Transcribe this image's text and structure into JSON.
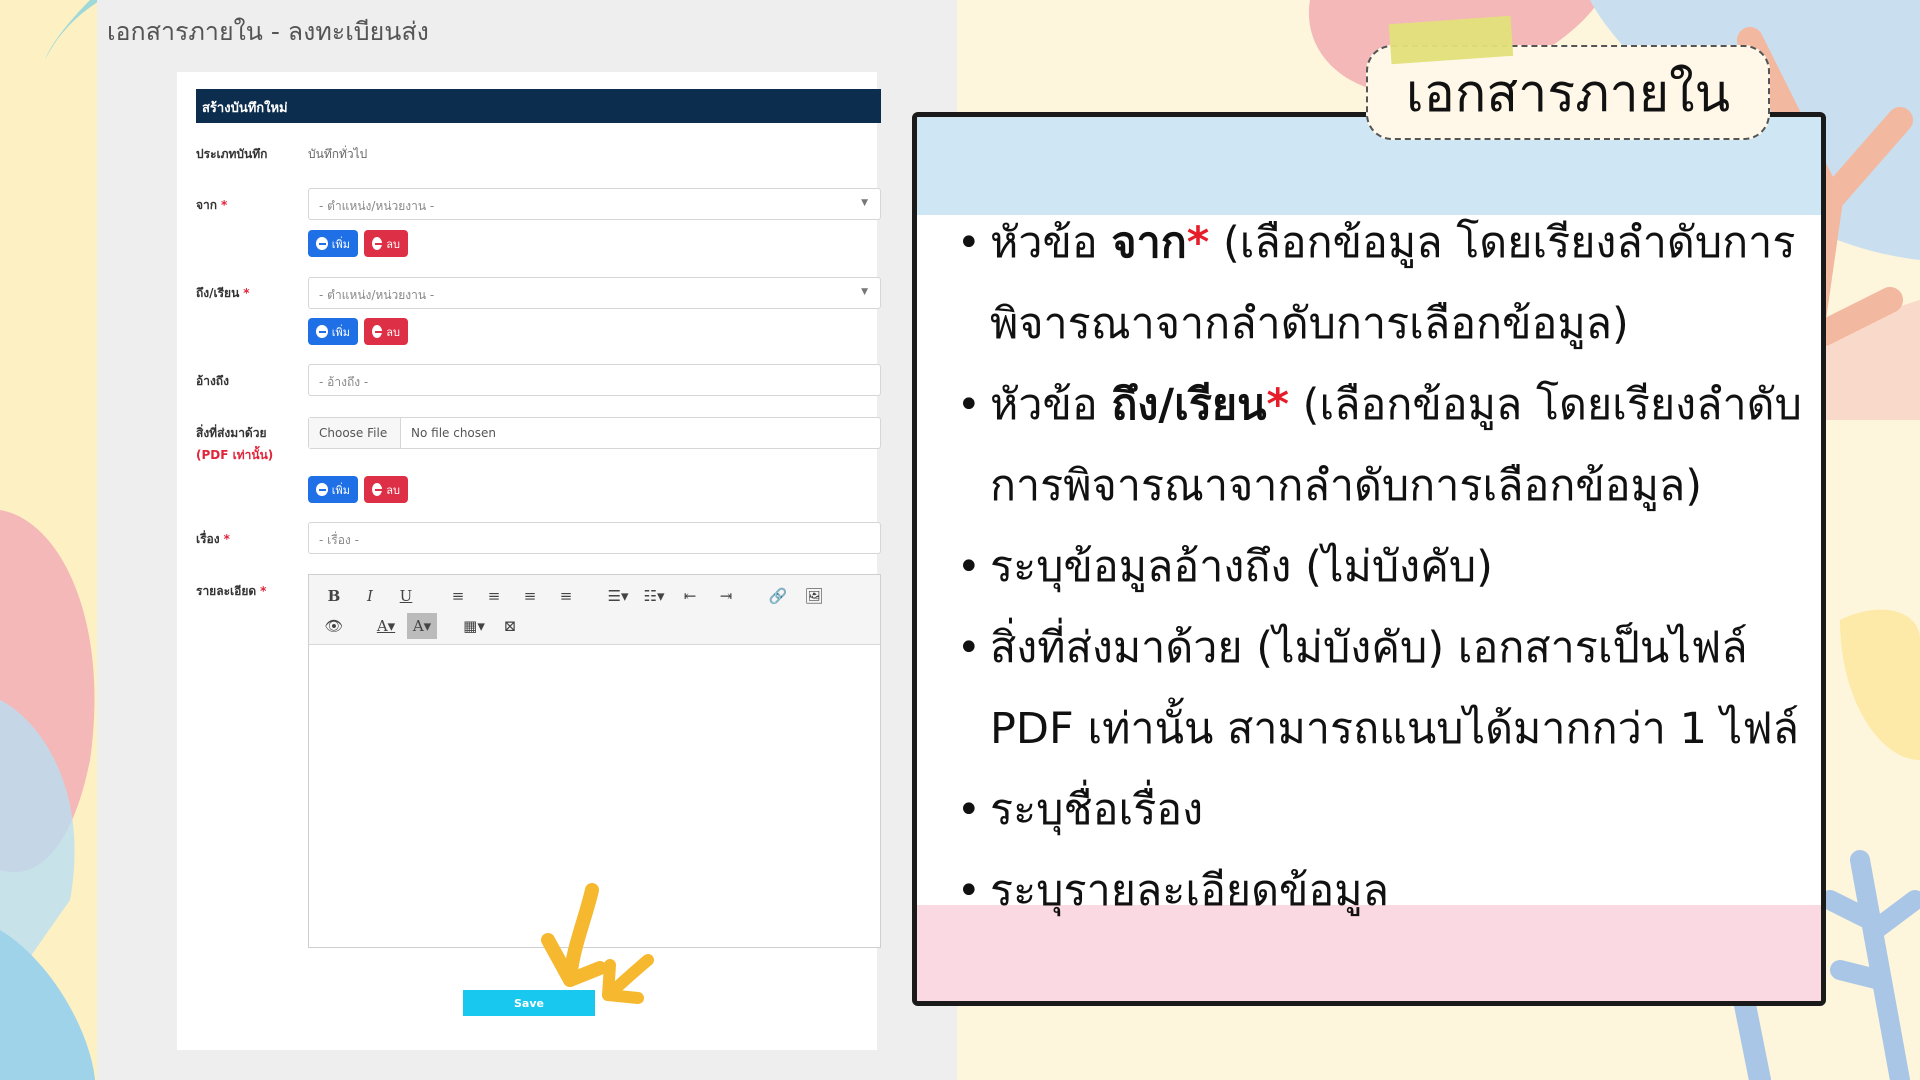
{
  "page_heading": "เอกสารภายใน - ลงทะเบียนส่ง",
  "form": {
    "header": "สร้างบันทึกใหม่",
    "record_type_label": "ประเภทบันทึก",
    "record_type_value": "บันทึกทั่วไป",
    "from_label": "จาก",
    "from_placeholder": "- ตำแหน่ง/หน่วยงาน -",
    "to_label": "ถึง/เรียน",
    "to_placeholder": "- ตำแหน่ง/หน่วยงาน -",
    "ref_label": "อ้างถึง",
    "ref_placeholder": "- อ้างถึง -",
    "attach_label": "สิ่งที่ส่งมาด้วย",
    "attach_note": "(PDF เท่านั้น)",
    "choose_file": "Choose File",
    "no_file": "No file chosen",
    "subject_label": "เรื่อง",
    "subject_placeholder": "- เรื่อง -",
    "detail_label": "รายละเอียด",
    "required_mark": "*",
    "add_label": "เพิ่ม",
    "delete_label": "ลบ",
    "save_label": "Save",
    "toolbar_row1": [
      "B",
      "I",
      "U",
      "≡",
      "≡",
      "≡",
      "≡",
      "☰▾",
      "☷▾",
      "⇤",
      "⇥",
      "🔗",
      "🖼"
    ],
    "toolbar_row2": [
      "👁",
      "A▾",
      "A▾",
      "▦▾",
      "⊠"
    ]
  },
  "note": {
    "title": "เอกสารภายใน",
    "items": [
      {
        "pre": "หัวข้อ ",
        "kw": "จาก",
        "star": "*",
        "post": " (เลือกข้อมูล โดยเรียงลำดับการพิจารณาจากลำดับการเลือกข้อมูล)"
      },
      {
        "pre": "หัวข้อ ",
        "kw": "ถึง/เรียน",
        "star": "*",
        "post": " (เลือกข้อมูล โดยเรียงลำดับการพิจารณาจากลำดับการเลือกข้อมูล)"
      },
      {
        "pre": "ระบุข้อมูลอ้างถึง (ไม่บังคับ)",
        "kw": "",
        "star": "",
        "post": ""
      },
      {
        "pre": "สิ่งที่ส่งมาด้วย (ไม่บังคับ) เอกสารเป็นไฟล์ PDF เท่านั้น สามารถแนบได้มากกว่า 1 ไฟล์",
        "kw": "",
        "star": "",
        "post": ""
      },
      {
        "pre": "ระบุชื่อเรื่อง",
        "kw": "",
        "star": "",
        "post": ""
      },
      {
        "pre": "ระบุรายละเอียดข้อมูล",
        "kw": "",
        "star": "",
        "post": ""
      }
    ]
  },
  "colors": {
    "form_header_bg": "#0c2d4e",
    "add_button": "#1f6fe6",
    "delete_button": "#dd2f45",
    "save_button": "#18c8ee",
    "required_star": "#e61e2a",
    "arrow": "#f5b82e"
  }
}
